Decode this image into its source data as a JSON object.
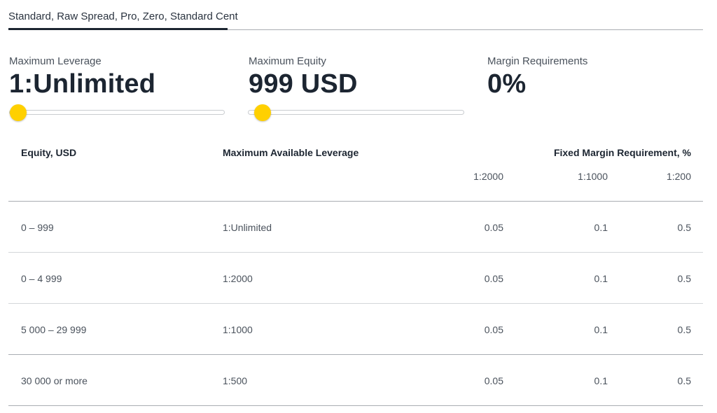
{
  "tabs": {
    "active_label": "Standard, Raw Spread, Pro, Zero, Standard Cent"
  },
  "metrics": {
    "leverage": {
      "label": "Maximum Leverage",
      "value": "1:Unlimited"
    },
    "equity": {
      "label": "Maximum Equity",
      "value": "999 USD"
    },
    "margin": {
      "label": "Margin Requirements",
      "value": "0%"
    }
  },
  "sliders": {
    "leverage": {
      "fraction": 0.0
    },
    "equity": {
      "fraction": 0.03
    }
  },
  "colors": {
    "accent": "#ffd000",
    "text_dark": "#1c2531",
    "text_muted": "#4a525c",
    "divider": "#a9adb2"
  },
  "table": {
    "headers": {
      "equity": "Equity, USD",
      "leverage": "Maximum Available Leverage",
      "margin": "Fixed Margin Requirement, %"
    },
    "margin_subheaders": [
      "1:2000",
      "1:1000",
      "1:200"
    ],
    "rows": [
      {
        "equity": "0 – 999",
        "leverage": "1:Unlimited",
        "m2000": "0.05",
        "m1000": "0.1",
        "m200": "0.5"
      },
      {
        "equity": "0 – 4 999",
        "leverage": "1:2000",
        "m2000": "0.05",
        "m1000": "0.1",
        "m200": "0.5"
      },
      {
        "equity": "5 000 – 29 999",
        "leverage": "1:1000",
        "m2000": "0.05",
        "m1000": "0.1",
        "m200": "0.5"
      },
      {
        "equity": "30 000 or more",
        "leverage": "1:500",
        "m2000": "0.05",
        "m1000": "0.1",
        "m200": "0.5"
      }
    ]
  }
}
